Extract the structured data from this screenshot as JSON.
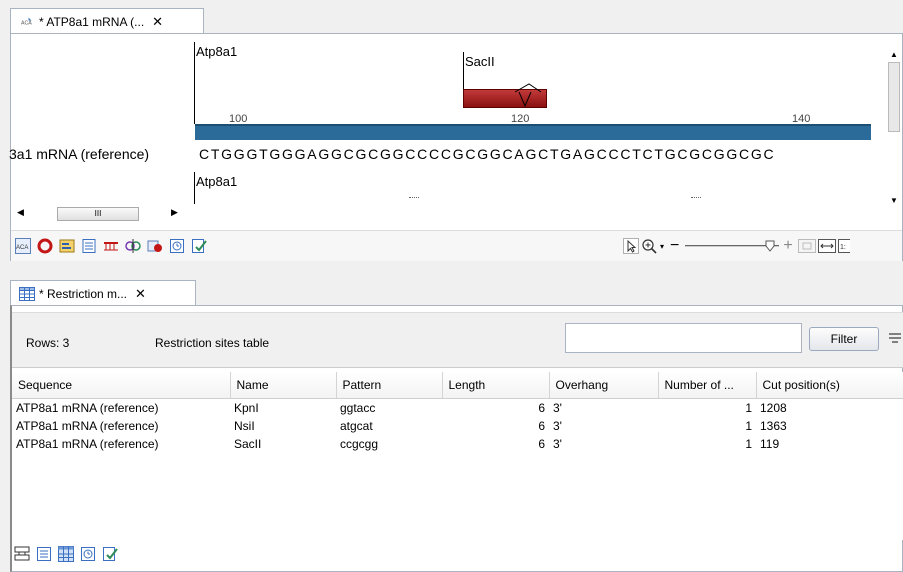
{
  "top_tab": {
    "icon": "dna-sequence-icon",
    "title": "* ATP8a1 mRNA (...",
    "close": "✕"
  },
  "sequence_view": {
    "gene_label_top": "Atp8a1",
    "enzyme_label": "SacII",
    "ruler_ticks": [
      "100",
      "120",
      "140"
    ],
    "sequence_name": "3a1 mRNA (reference)",
    "sequence": "CTGGGTGGGAGGCGCGGCCCCGCGGCAGCTGAGCCCTCTGCGCGGCGC",
    "gene_label_bottom": "Atp8a1",
    "scroll_dots": "III"
  },
  "view_toolbar": {
    "icons": [
      "sequence-view-icon",
      "circular-view-icon",
      "annotation-table-icon",
      "text-view-icon",
      "restriction-map-icon",
      "cut-sites-icon",
      "settings-icon",
      "history-icon",
      "element-info-icon"
    ],
    "zoom_minus": "−",
    "zoom_plus": "+"
  },
  "bottom_tab": {
    "icon": "table-icon",
    "title": "* Restriction m...",
    "close": "✕"
  },
  "table_header": {
    "rows_label": "Rows: 3",
    "table_title": "Restriction sites table",
    "filter_placeholder": "",
    "filter_button": "Filter"
  },
  "table": {
    "columns": [
      "Sequence",
      "Name",
      "Pattern",
      "Length",
      "Overhang",
      "Number of ...",
      "Cut position(s)"
    ],
    "rows": [
      [
        "ATP8a1 mRNA (reference)",
        "KpnI",
        "ggtacc",
        "6",
        "3'",
        "1",
        "1208"
      ],
      [
        "ATP8a1 mRNA (reference)",
        "NsiI",
        "atgcat",
        "6",
        "3'",
        "1",
        "1363"
      ],
      [
        "ATP8a1 mRNA (reference)",
        "SacII",
        "ccgcgg",
        "6",
        "3'",
        "1",
        "119"
      ]
    ]
  },
  "bottom_toolbar": {
    "icons": [
      "graphical-view-icon",
      "list-view-icon",
      "table-view-icon",
      "history-icon",
      "element-info-icon"
    ]
  }
}
